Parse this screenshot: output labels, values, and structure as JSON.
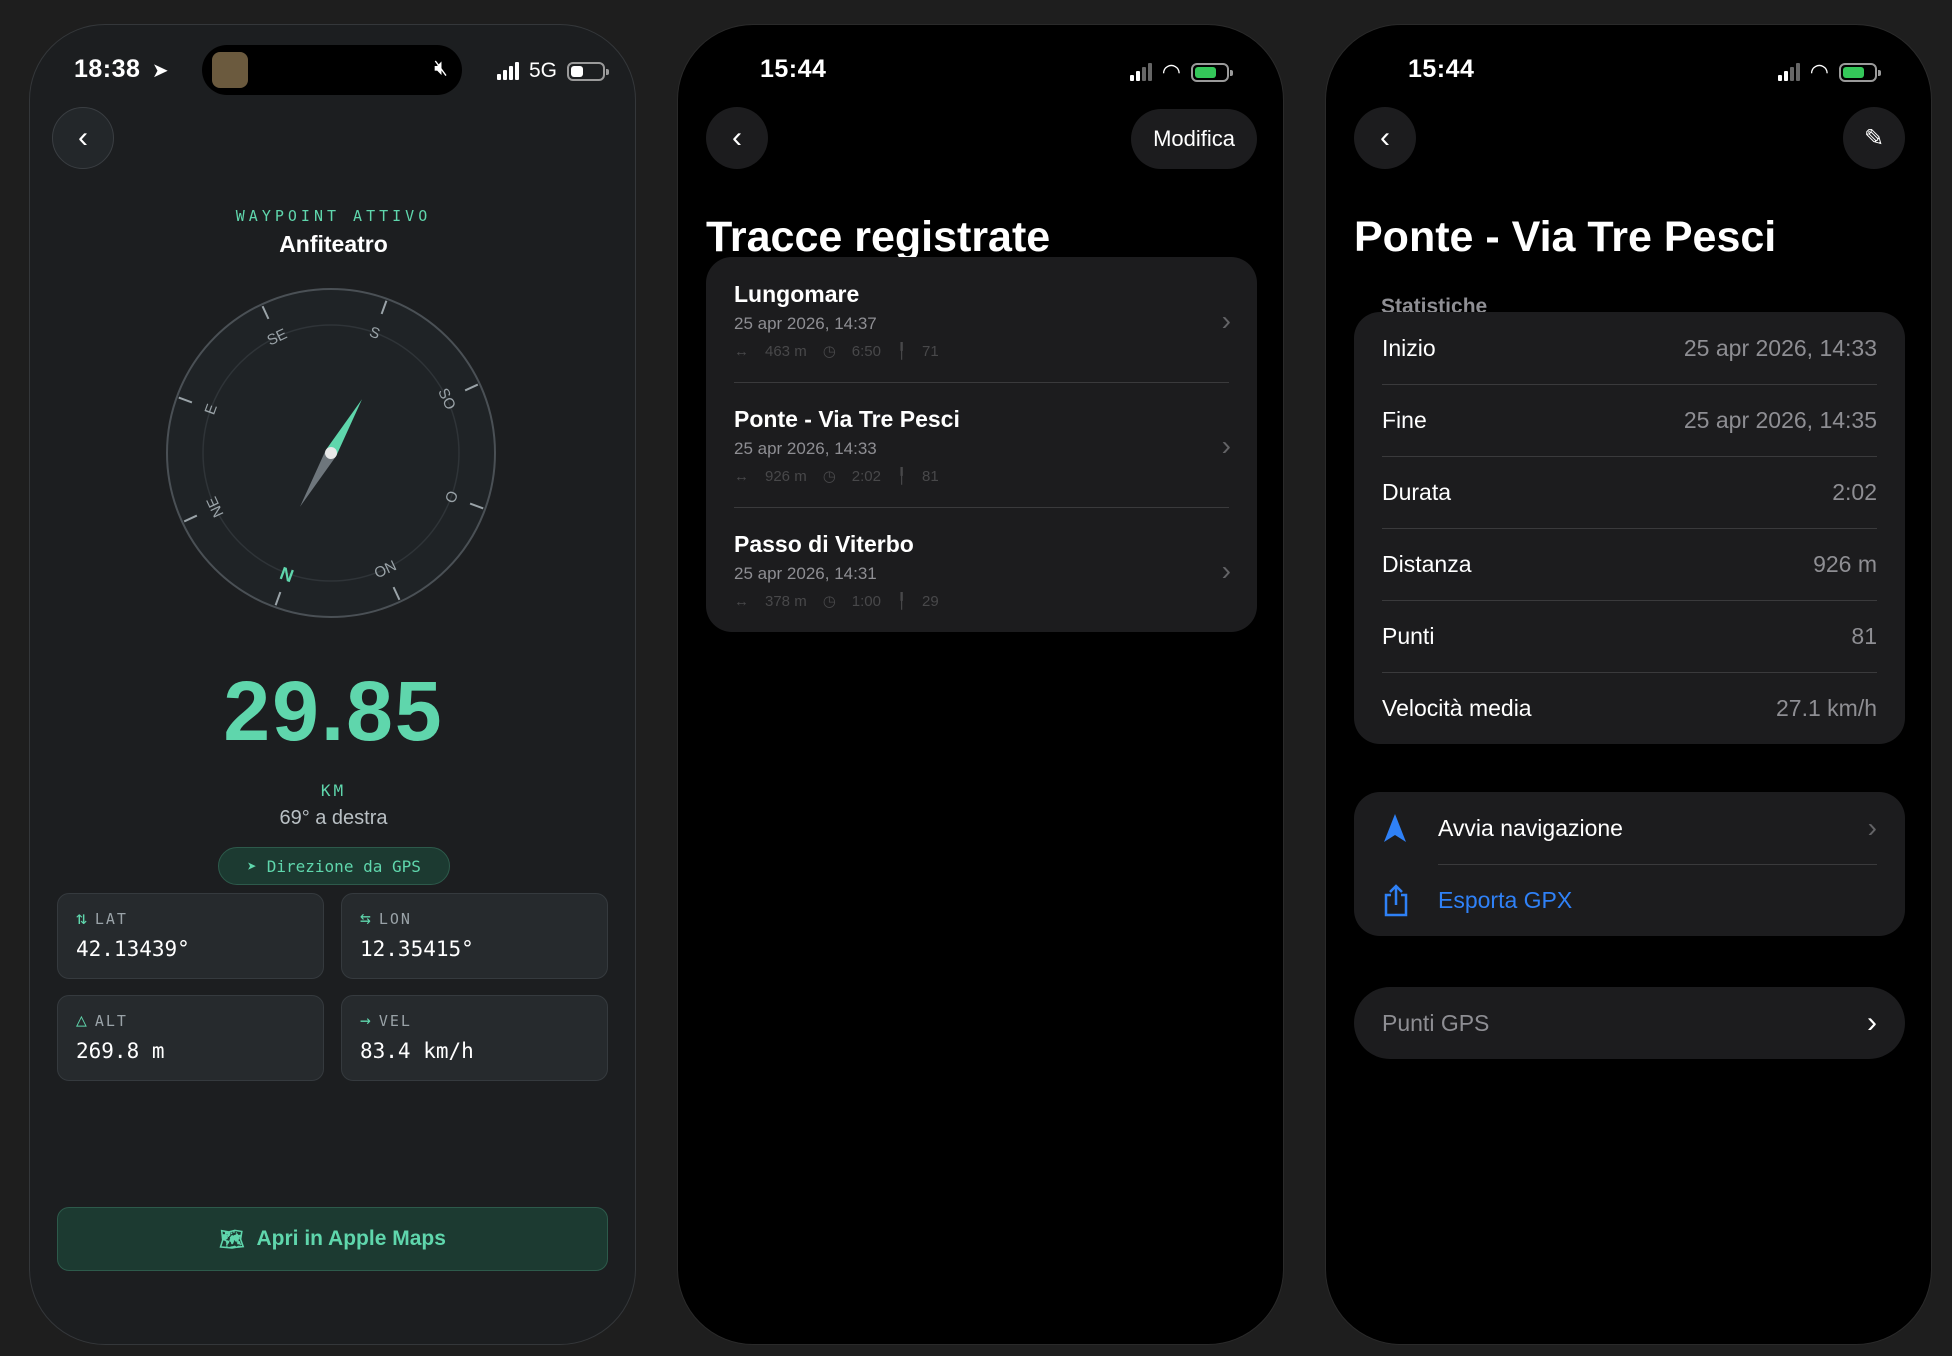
{
  "colors": {
    "accent": "#5fd6ac",
    "ios_blue": "#2f81f7",
    "battery_green": "#34c759",
    "battery_yellow": "#ffd60a"
  },
  "phone1": {
    "status": {
      "time": "18:38",
      "network": "5G"
    },
    "waypoint_label": "WAYPOINT ATTIVO",
    "waypoint_name": "Anfiteatro",
    "compass": {
      "heading_deg": 69,
      "dial_labels": [
        "N",
        "NE",
        "E",
        "SE",
        "S",
        "SO",
        "O",
        "NO"
      ]
    },
    "distance_value": "29.85",
    "distance_unit": "KM",
    "direction_text": "69° a destra",
    "gps_badge": "Direzione da GPS",
    "coords": [
      {
        "label": "LAT",
        "icon": "arrows-updown-icon",
        "value": "42.13439°"
      },
      {
        "label": "LON",
        "icon": "arrows-leftright-icon",
        "value": "12.35415°"
      },
      {
        "label": "ALT",
        "icon": "triangle-icon",
        "value": "269.8 m"
      },
      {
        "label": "VEL",
        "icon": "arrow-right-icon",
        "value": "83.4 km/h"
      }
    ],
    "maps_button": "Apri in Apple Maps"
  },
  "phone2": {
    "status": {
      "time": "15:44"
    },
    "edit_button": "Modifica",
    "title": "Tracce registrate",
    "tracks": [
      {
        "name": "Lungomare",
        "date": "25 apr 2026, 14:37",
        "distance": "463 m",
        "duration": "6:50",
        "points": "71"
      },
      {
        "name": "Ponte - Via Tre Pesci",
        "date": "25 apr 2026, 14:33",
        "distance": "926 m",
        "duration": "2:02",
        "points": "81"
      },
      {
        "name": "Passo di Viterbo",
        "date": "25 apr 2026, 14:31",
        "distance": "378 m",
        "duration": "1:00",
        "points": "29"
      }
    ]
  },
  "phone3": {
    "status": {
      "time": "15:44"
    },
    "title": "Ponte - Via Tre Pesci",
    "section_title": "Statistiche",
    "stats": [
      {
        "key": "Inizio",
        "value": "25 apr 2026, 14:33"
      },
      {
        "key": "Fine",
        "value": "25 apr 2026, 14:35"
      },
      {
        "key": "Durata",
        "value": "2:02"
      },
      {
        "key": "Distanza",
        "value": "926 m"
      },
      {
        "key": "Punti",
        "value": "81"
      },
      {
        "key": "Velocità media",
        "value": "27.1 km/h"
      }
    ],
    "actions": [
      {
        "label": "Avvia navigazione",
        "icon": "navigation-arrow-icon"
      },
      {
        "label": "Esporta GPX",
        "icon": "share-icon"
      }
    ],
    "gps_points_row": "Punti GPS"
  }
}
